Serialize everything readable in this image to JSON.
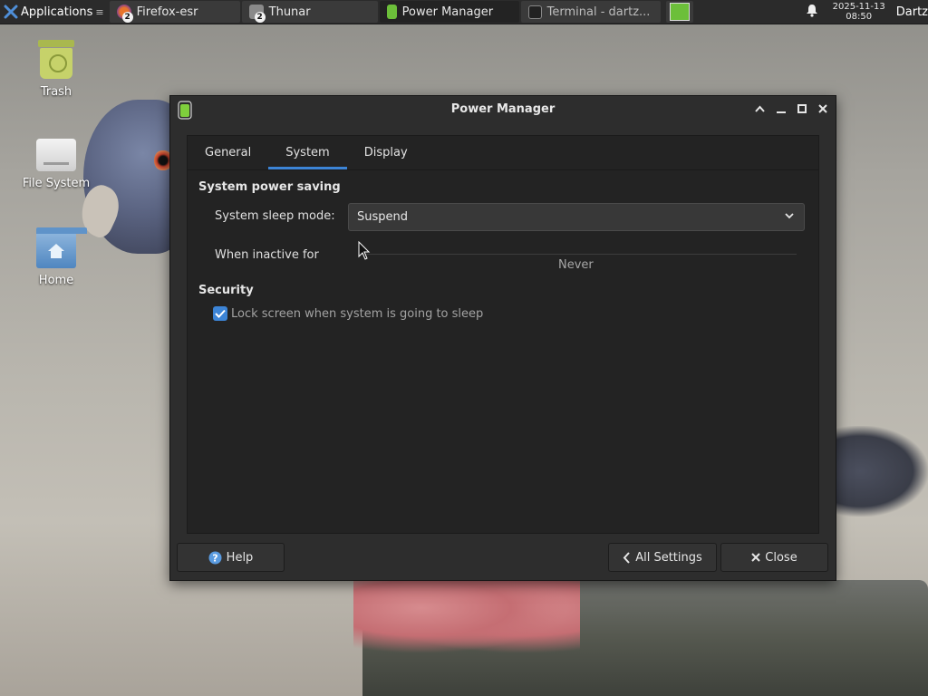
{
  "taskbar": {
    "apps_label": "Applications",
    "tasks": [
      {
        "label": "Firefox-esr",
        "badge": "2"
      },
      {
        "label": "Thunar",
        "badge": "2"
      },
      {
        "label": "Power Manager"
      },
      {
        "label": "Terminal - dartz..."
      }
    ],
    "clock_date": "2025-11-13",
    "clock_time": "08:50",
    "user": "Dartz"
  },
  "desktop": {
    "icons": [
      {
        "label": "Trash"
      },
      {
        "label": "File System"
      },
      {
        "label": "Home"
      }
    ]
  },
  "window": {
    "title": "Power Manager",
    "tabs": [
      {
        "label": "General"
      },
      {
        "label": "System"
      },
      {
        "label": "Display"
      }
    ],
    "active_tab": "System",
    "system_power_saving": {
      "heading": "System power saving",
      "sleep_mode_label": "System sleep mode:",
      "sleep_mode_value": "Suspend",
      "inactive_label": "When inactive for",
      "inactive_value": "Never"
    },
    "security": {
      "heading": "Security",
      "lock_label": "Lock screen when system is going to sleep",
      "lock_checked": true
    },
    "buttons": {
      "help": "Help",
      "all_settings": "All Settings",
      "close": "Close"
    }
  },
  "colors": {
    "accent": "#3c84d6",
    "window_bg": "#2d2d2d",
    "panel_bg": "#232323",
    "taskbar_bg": "#2b2b2b"
  }
}
